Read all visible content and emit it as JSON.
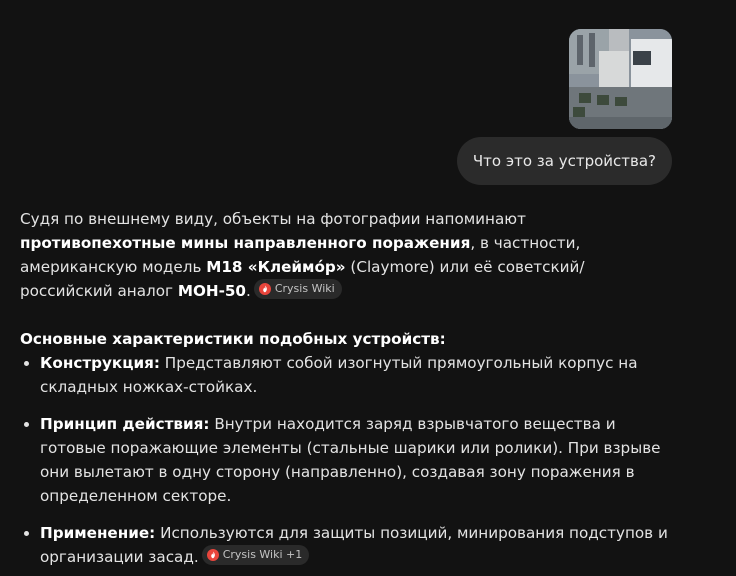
{
  "user_message": {
    "photo_icon": "photo-thumbnail",
    "text": "Что это за устройства?"
  },
  "answer": {
    "intro": {
      "t1": "Судя по внешнему виду, объекты на фотографии напоминают ",
      "b1": "противопехотные мины направленного поражения",
      "t2": ", в частности, американскую модель ",
      "b2": "M18 «Клеймо́р»",
      "t3": " (Claymore) или её советский/российский аналог ",
      "b3": "МОН-50",
      "t4": "."
    },
    "intro_source": "Crysis Wiki",
    "heading": "Основные характеристики подобных устройств:",
    "items": [
      {
        "title": "Конструкция:",
        "text": " Представляют собой изогнутый прямоугольный корпус на складных ножках-стойках."
      },
      {
        "title": "Принцип действия:",
        "text": " Внутри находится заряд взрывчатого вещества и готовые поражающие элементы (стальные шарики или ролики). При взрыве они вылетают в одну сторону (направленно), создавая зону поражения в определенном секторе."
      },
      {
        "title": "Применение:",
        "text": " Используются для защиты позиций, минирования подступов и организации засад.",
        "source": "Crysis Wiki +1"
      }
    ]
  },
  "colors": {
    "background": "#121212",
    "bubble": "#2b2b2b",
    "chip": "#2a2a2a",
    "source_icon": "#e8453c"
  }
}
